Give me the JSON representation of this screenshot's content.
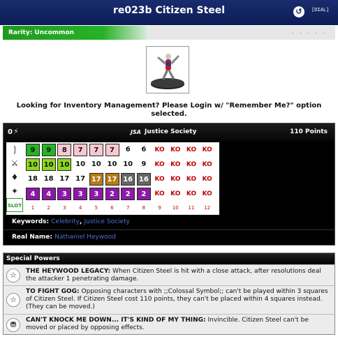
{
  "header": {
    "title": "re023b Citizen Steel",
    "back_icon": "refresh-icon",
    "dial_label": "[DIAL]"
  },
  "rarity": {
    "label": "Rarity: Uncommon",
    "dots": ". . . . ."
  },
  "inventory_notice": "Looking for Inventory Management? Please Login w/ \"Remember Me?\" option selected.",
  "stat_card": {
    "range": "0",
    "team_abbr": "JSA",
    "team_name": "Justice Society",
    "points": "110 Points",
    "slot_label": "SLOT",
    "slot_numbers": [
      "1",
      "2",
      "3",
      "4",
      "5",
      "6",
      "7",
      "8",
      "9",
      "10",
      "11",
      "12"
    ],
    "rows": [
      {
        "stat": "speed",
        "cells": [
          "9",
          "9",
          "8",
          "7",
          "7",
          "7",
          "6",
          "6",
          "KO",
          "KO",
          "KO",
          "KO"
        ],
        "colors": [
          "#27b327",
          "#27b327",
          "#f7c8d0",
          "#f7c8d0",
          "#f7c8d0",
          "#f7c8d0",
          "#ffffff",
          "#ffffff",
          "#ffffff",
          "#ffffff",
          "#ffffff",
          "#ffffff"
        ]
      },
      {
        "stat": "attack",
        "cells": [
          "10",
          "10",
          "10",
          "10",
          "10",
          "10",
          "10",
          "9",
          "KO",
          "KO",
          "KO",
          "KO"
        ],
        "colors": [
          "#8dd81c",
          "#8dd81c",
          "#8dd81c",
          "#ffffff",
          "#ffffff",
          "#ffffff",
          "#ffffff",
          "#ffffff",
          "#ffffff",
          "#ffffff",
          "#ffffff",
          "#ffffff"
        ]
      },
      {
        "stat": "defense",
        "cells": [
          "18",
          "18",
          "17",
          "17",
          "17",
          "17",
          "16",
          "16",
          "KO",
          "KO",
          "KO",
          "KO"
        ],
        "colors": [
          "#ffffff",
          "#ffffff",
          "#ffffff",
          "#ffffff",
          "#b97a16",
          "#b97a16",
          "#666666",
          "#666666",
          "#ffffff",
          "#ffffff",
          "#ffffff",
          "#ffffff"
        ]
      },
      {
        "stat": "damage",
        "cells": [
          "4",
          "4",
          "3",
          "3",
          "3",
          "2",
          "2",
          "2",
          "KO",
          "KO",
          "KO",
          "KO"
        ],
        "colors": [
          "#8c1aa6",
          "#8c1aa6",
          "#8c1aa6",
          "#8c1aa6",
          "#8c1aa6",
          "#8c1aa6",
          "#8c1aa6",
          "#8c1aa6",
          "#ffffff",
          "#ffffff",
          "#ffffff",
          "#ffffff"
        ]
      }
    ],
    "keywords_label": "Keywords:",
    "keywords": [
      "Celebrity",
      "Justice Society"
    ],
    "keyword_sep": ", ",
    "real_name_label": "Real Name:",
    "real_name": "Nathaniel Heywood"
  },
  "special_powers": {
    "title": "Special Powers",
    "powers": [
      {
        "icon": "star-icon",
        "name": "THE HEYWOOD LEGACY:",
        "text": "When Citizen Steel is hit with a close attack, after resolutions deal the attacker 1 penetrating damage."
      },
      {
        "icon": "star-icon",
        "name": "TO FIGHT GOG:",
        "text": "Opposing characters with ;;Colossal Symbol;; can't be played within 3 squares of Citizen Steel. If Citizen Steel cost 110 points, they can't be placed within 4 squares instead. (They can be moved.)"
      },
      {
        "icon": "shield-icon",
        "name": "CAN'T KNOCK ME DOWN... IT'S KIND OF MY THING:",
        "text": "Invincible. Citizen Steel can't be moved or placed by opposing effects."
      }
    ]
  }
}
